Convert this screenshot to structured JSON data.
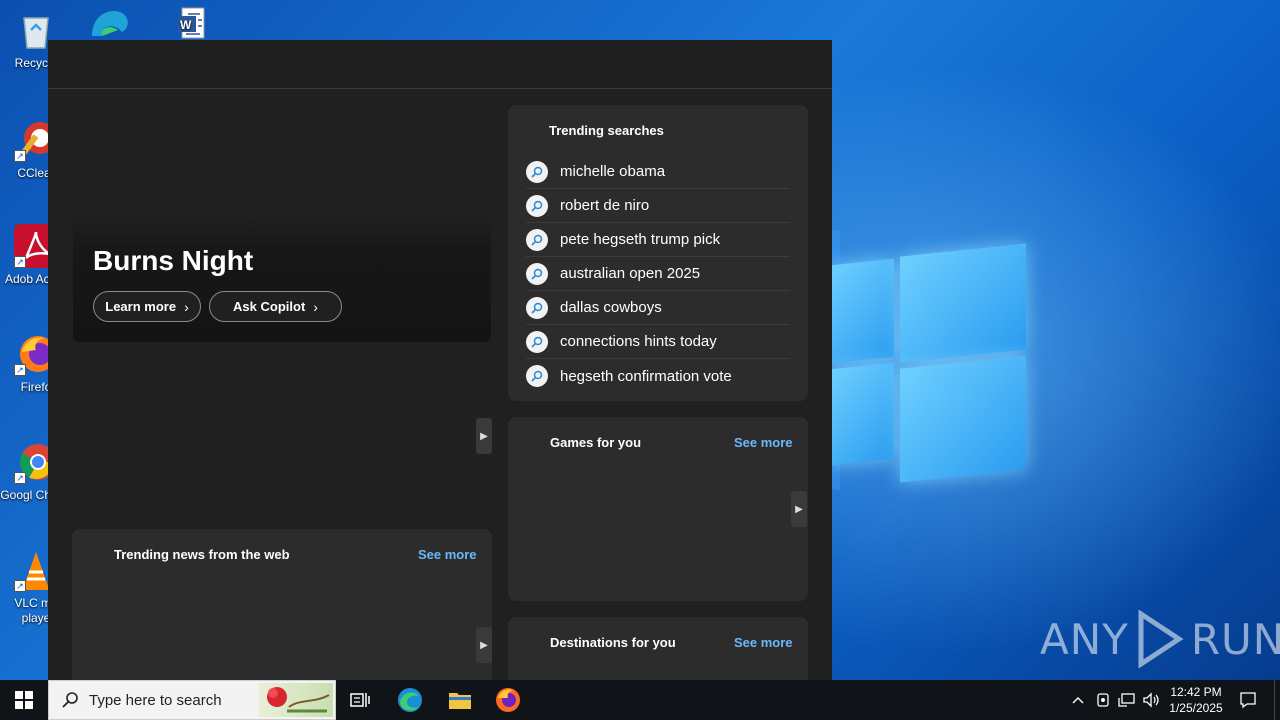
{
  "desktop": {
    "icons": [
      {
        "label": "Recycle"
      },
      {
        "label": "CClear"
      },
      {
        "label": "Adob Acrob"
      },
      {
        "label": "Firefo"
      },
      {
        "label": "Googl Chrom"
      },
      {
        "label": "VLC me playe"
      }
    ],
    "watermark": "ANY RUN"
  },
  "widgets": {
    "hero": {
      "title": "Burns Night",
      "learn_more": "Learn more",
      "ask_copilot": "Ask Copilot"
    },
    "trending_searches": {
      "title": "Trending searches",
      "items": [
        "michelle obama",
        "robert de niro",
        "pete hegseth trump pick",
        "australian open 2025",
        "dallas cowboys",
        "connections hints today",
        "hegseth confirmation vote"
      ]
    },
    "games": {
      "title": "Games for you",
      "see_more": "See more"
    },
    "news": {
      "title": "Trending news from the web",
      "see_more": "See more"
    },
    "destinations": {
      "title": "Destinations for you",
      "see_more": "See more"
    }
  },
  "taskbar": {
    "search_placeholder": "Type here to search",
    "time": "12:42 PM",
    "date": "1/25/2025"
  }
}
